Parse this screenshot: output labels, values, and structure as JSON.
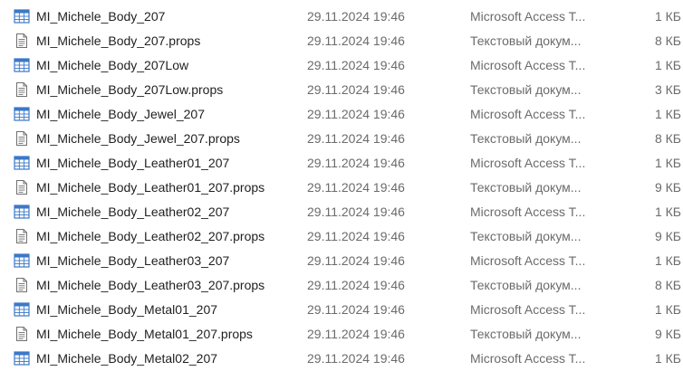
{
  "files": [
    {
      "name": "MI_Michele_Body_207",
      "date": "29.11.2024 19:46",
      "type": "Microsoft Access T...",
      "size": "1 КБ",
      "icon": "table-icon"
    },
    {
      "name": "MI_Michele_Body_207.props",
      "date": "29.11.2024 19:46",
      "type": "Текстовый докум...",
      "size": "8 КБ",
      "icon": "text-document-icon"
    },
    {
      "name": "MI_Michele_Body_207Low",
      "date": "29.11.2024 19:46",
      "type": "Microsoft Access T...",
      "size": "1 КБ",
      "icon": "table-icon"
    },
    {
      "name": "MI_Michele_Body_207Low.props",
      "date": "29.11.2024 19:46",
      "type": "Текстовый докум...",
      "size": "3 КБ",
      "icon": "text-document-icon"
    },
    {
      "name": "MI_Michele_Body_Jewel_207",
      "date": "29.11.2024 19:46",
      "type": "Microsoft Access T...",
      "size": "1 КБ",
      "icon": "table-icon"
    },
    {
      "name": "MI_Michele_Body_Jewel_207.props",
      "date": "29.11.2024 19:46",
      "type": "Текстовый докум...",
      "size": "8 КБ",
      "icon": "text-document-icon"
    },
    {
      "name": "MI_Michele_Body_Leather01_207",
      "date": "29.11.2024 19:46",
      "type": "Microsoft Access T...",
      "size": "1 КБ",
      "icon": "table-icon"
    },
    {
      "name": "MI_Michele_Body_Leather01_207.props",
      "date": "29.11.2024 19:46",
      "type": "Текстовый докум...",
      "size": "9 КБ",
      "icon": "text-document-icon"
    },
    {
      "name": "MI_Michele_Body_Leather02_207",
      "date": "29.11.2024 19:46",
      "type": "Microsoft Access T...",
      "size": "1 КБ",
      "icon": "table-icon"
    },
    {
      "name": "MI_Michele_Body_Leather02_207.props",
      "date": "29.11.2024 19:46",
      "type": "Текстовый докум...",
      "size": "9 КБ",
      "icon": "text-document-icon"
    },
    {
      "name": "MI_Michele_Body_Leather03_207",
      "date": "29.11.2024 19:46",
      "type": "Microsoft Access T...",
      "size": "1 КБ",
      "icon": "table-icon"
    },
    {
      "name": "MI_Michele_Body_Leather03_207.props",
      "date": "29.11.2024 19:46",
      "type": "Текстовый докум...",
      "size": "8 КБ",
      "icon": "text-document-icon"
    },
    {
      "name": "MI_Michele_Body_Metal01_207",
      "date": "29.11.2024 19:46",
      "type": "Microsoft Access T...",
      "size": "1 КБ",
      "icon": "table-icon"
    },
    {
      "name": "MI_Michele_Body_Metal01_207.props",
      "date": "29.11.2024 19:46",
      "type": "Текстовый докум...",
      "size": "9 КБ",
      "icon": "text-document-icon"
    },
    {
      "name": "MI_Michele_Body_Metal02_207",
      "date": "29.11.2024 19:46",
      "type": "Microsoft Access T...",
      "size": "1 КБ",
      "icon": "table-icon"
    }
  ],
  "colors": {
    "table_icon_blue": "#3a78c9",
    "row_hover": "#e5f3ff",
    "secondary_text": "#6b6b6b"
  }
}
